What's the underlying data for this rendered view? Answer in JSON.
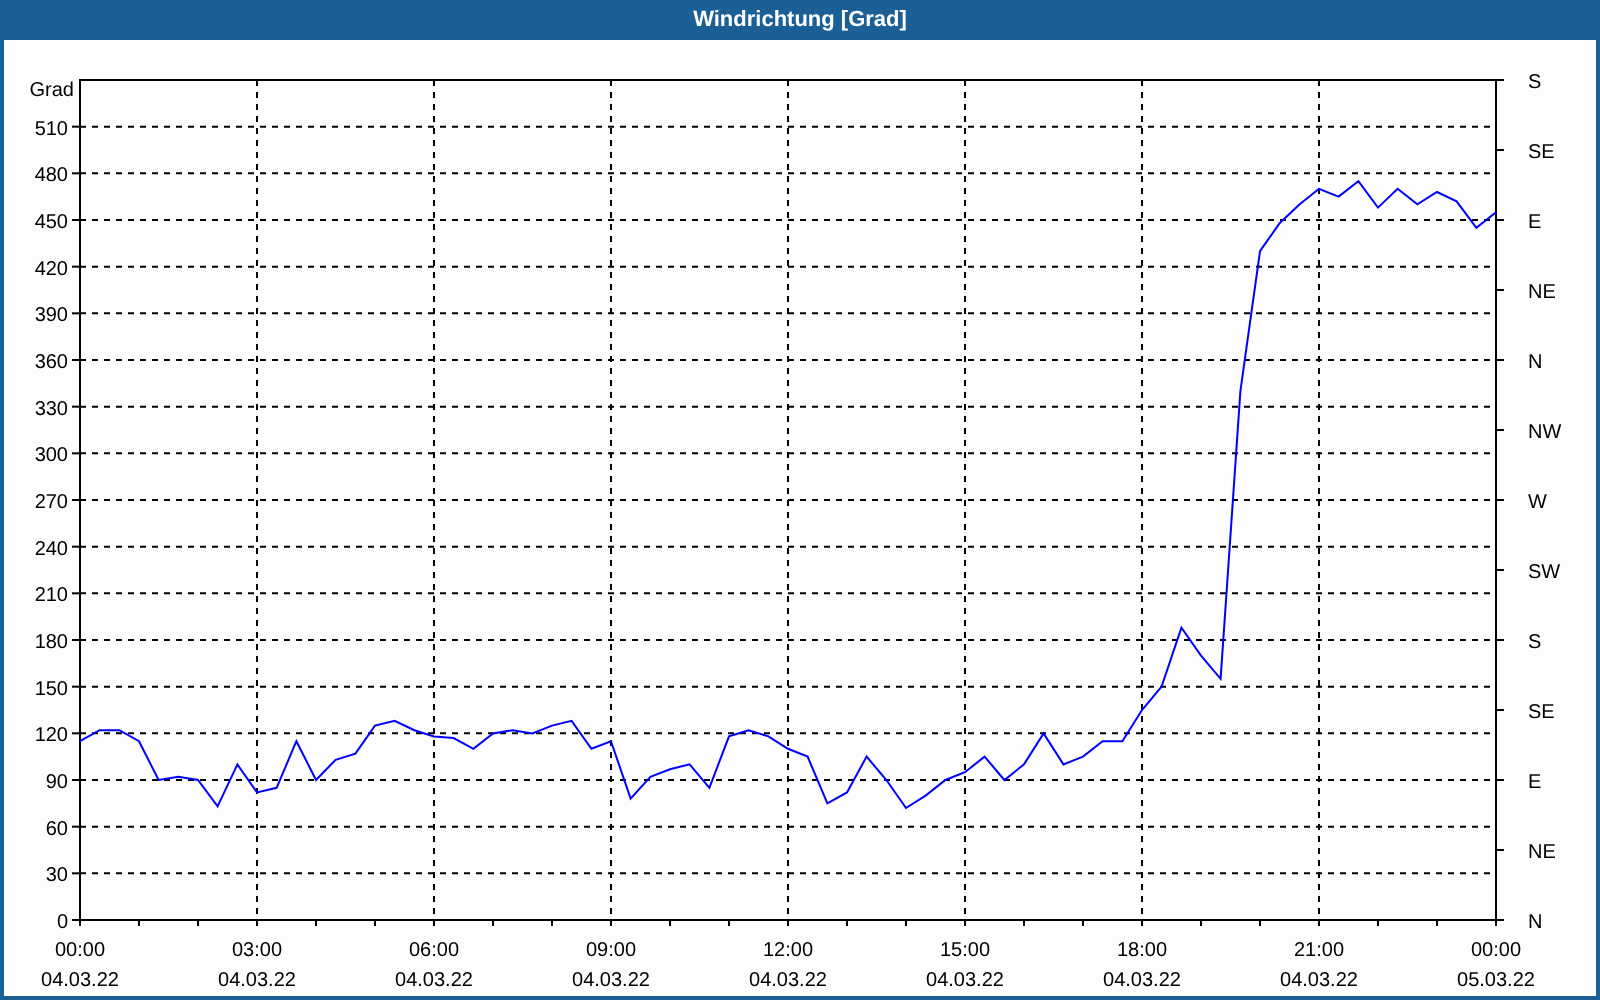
{
  "window": {
    "title": "Windrichtung [Grad]"
  },
  "chart": {
    "right_axis_labels": [
      "S",
      "SE",
      "E",
      "NE",
      "N",
      "NW",
      "W",
      "SW",
      "S",
      "SE",
      "E",
      "NE",
      "N"
    ],
    "x_dates": [
      "04.03.22",
      "04.03.22",
      "04.03.22",
      "04.03.22",
      "04.03.22",
      "04.03.22",
      "04.03.22",
      "04.03.22",
      "05.03.22"
    ],
    "chart_data": {
      "type": "line",
      "grid": true,
      "ylabel": "Grad",
      "xlim": [
        0,
        24
      ],
      "ylim": [
        0,
        540
      ],
      "xticks": [
        {
          "value": 0,
          "label": "00:00"
        },
        {
          "value": 3,
          "label": "03:00"
        },
        {
          "value": 6,
          "label": "06:00"
        },
        {
          "value": 9,
          "label": "09:00"
        },
        {
          "value": 12,
          "label": "12:00"
        },
        {
          "value": 15,
          "label": "15:00"
        },
        {
          "value": 18,
          "label": "18:00"
        },
        {
          "value": 21,
          "label": "21:00"
        },
        {
          "value": 24,
          "label": "00:00"
        }
      ],
      "yticks": [
        0,
        30,
        60,
        90,
        120,
        150,
        180,
        210,
        240,
        270,
        300,
        330,
        360,
        390,
        420,
        450,
        480,
        510
      ],
      "x": [
        0,
        0.333,
        0.667,
        1,
        1.333,
        1.667,
        2,
        2.333,
        2.667,
        3,
        3.333,
        3.667,
        4,
        4.333,
        4.667,
        5,
        5.333,
        5.667,
        6,
        6.333,
        6.667,
        7,
        7.333,
        7.667,
        8,
        8.333,
        8.667,
        9,
        9.333,
        9.667,
        10,
        10.333,
        10.667,
        11,
        11.333,
        11.667,
        12,
        12.333,
        12.667,
        13,
        13.333,
        13.667,
        14,
        14.333,
        14.667,
        15,
        15.333,
        15.667,
        16,
        16.333,
        16.667,
        17,
        17.333,
        17.667,
        18,
        18.333,
        18.667,
        19,
        19.333,
        19.667,
        20,
        20.333,
        20.667,
        21,
        21.333,
        21.667,
        22,
        22.333,
        22.667,
        23,
        23.333,
        23.667,
        24
      ],
      "series": [
        {
          "color": "#0000ff",
          "values": [
            115,
            122,
            122,
            115,
            90,
            92,
            90,
            73,
            100,
            82,
            85,
            115,
            90,
            103,
            107,
            125,
            128,
            122,
            118,
            117,
            110,
            120,
            122,
            120,
            125,
            128,
            110,
            115,
            78,
            92,
            97,
            100,
            85,
            118,
            122,
            118,
            110,
            105,
            75,
            82,
            105,
            90,
            72,
            80,
            90,
            95,
            105,
            90,
            100,
            120,
            100,
            105,
            115,
            115,
            135,
            150,
            188,
            170,
            155,
            340,
            430,
            448,
            460,
            470,
            465,
            475,
            458,
            470,
            460,
            468,
            462,
            445,
            455
          ]
        }
      ]
    }
  }
}
